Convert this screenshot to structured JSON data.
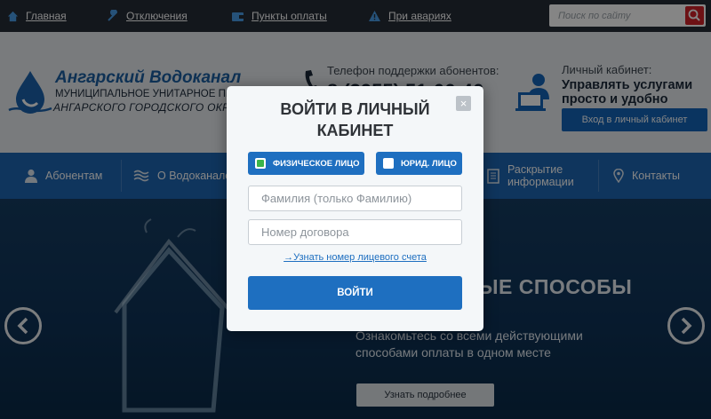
{
  "topbar": {
    "links": [
      "Главная",
      "Отключения",
      "Пункты оплаты",
      "При авариях"
    ],
    "search_placeholder": "Поиск по сайту"
  },
  "header": {
    "logo_title": "Ангарский Водоканал",
    "logo_line2": "МУНИЦИПАЛЬНОЕ УНИТАРНОЕ ПРЕДПРИЯТИЕ",
    "logo_line3": "АНГАРСКОГО ГОРОДСКОГО ОКРУГА",
    "phone_label": "Телефон поддержки абонентов:",
    "phone_number": "8 (3955) 51-06-46",
    "cabinet_label": "Личный кабинет:",
    "cabinet_line1": "Управлять услугами",
    "cabinet_line2": "просто и удобно",
    "cabinet_button": "Вход в личный кабинет"
  },
  "nav": {
    "items": [
      "Абонентам",
      "О Водоканале",
      "Раскрытие информации",
      "Контакты"
    ]
  },
  "hero": {
    "title": "ЫЕ СПОСОБЫ",
    "text_line1": "Ознакомьтесь со всеми действующими",
    "text_line2": "способами оплаты в одном месте",
    "button": "Узнать подробнее"
  },
  "modal": {
    "title_line1": "ВОЙТИ В ЛИЧНЫЙ",
    "title_line2": "КАБИНЕТ",
    "close": "×",
    "tab_physical": "ФИЗИЧЕСКОЕ ЛИЦО",
    "tab_legal": "ЮРИД. ЛИЦО",
    "surname_placeholder": "Фамилия (только Фамилию)",
    "contract_placeholder": "Номер договора",
    "link": "→Узнать номер лицевого счета",
    "submit": "ВОЙТИ"
  }
}
